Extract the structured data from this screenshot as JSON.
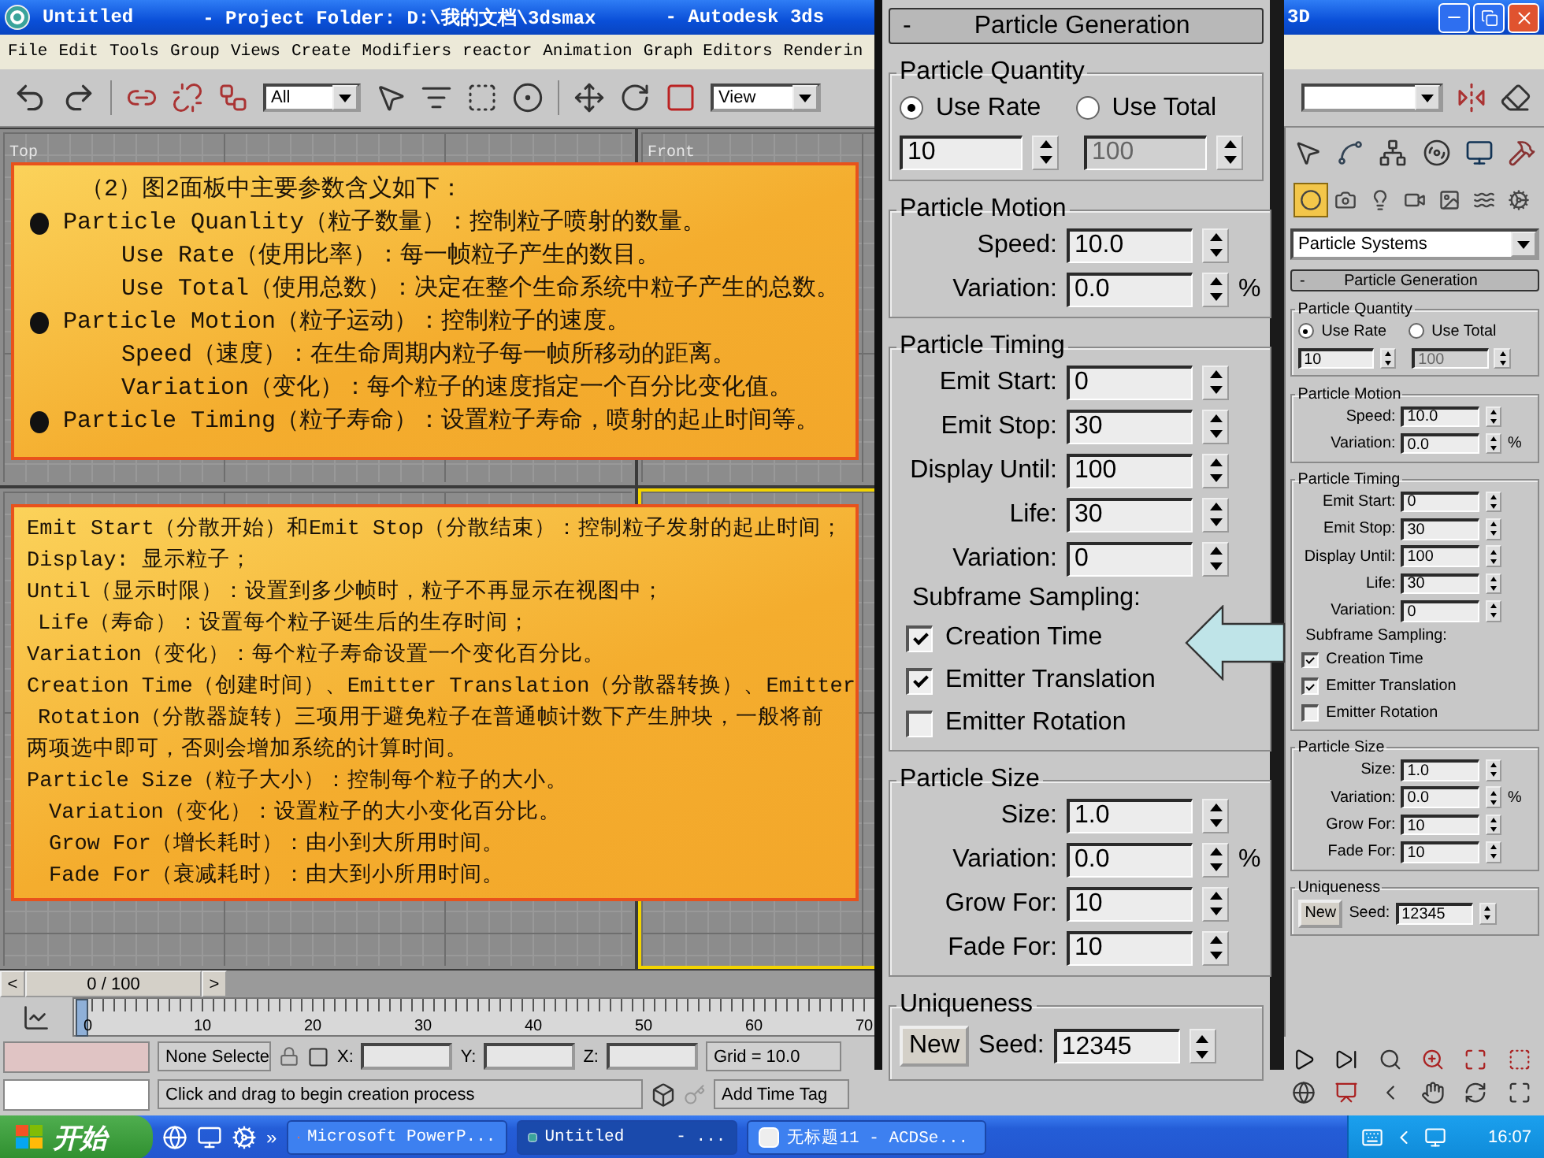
{
  "window": {
    "title": [
      "Untitled",
      "- Project Folder: D:\\我的文档\\3dsmax",
      "- Autodesk 3ds"
    ],
    "title_tail": "3D"
  },
  "menu": [
    "File",
    "Edit",
    "Tools",
    "Group",
    "Views",
    "Create",
    "Modifiers",
    "reactor",
    "Animation",
    "Graph Editors",
    "Renderin"
  ],
  "toolbar": {
    "selection_filter": "All",
    "reference_coord": "View"
  },
  "viewports": [
    {
      "label": "Top",
      "active": false
    },
    {
      "label": "Front",
      "active": false
    },
    {
      "active": false
    },
    {
      "active": true
    }
  ],
  "command_panel": {
    "object_types": [
      {
        "selected": true
      },
      {
        "selected": false
      },
      {
        "selected": false
      },
      {
        "selected": false
      },
      {
        "selected": false
      },
      {
        "selected": false
      },
      {
        "selected": false
      }
    ],
    "category": "Particle Systems",
    "rollout": {
      "collapse": "-",
      "title": "Particle Generation",
      "groups": [
        {
          "kind": "quantity",
          "title": "Particle Quantity",
          "radios": [
            {
              "label": "Use Rate",
              "selected": true
            },
            {
              "label": "Use Total",
              "selected": false
            }
          ],
          "fields": [
            {
              "value": "10",
              "disabled": false
            },
            {
              "value": "100",
              "disabled": true
            }
          ]
        },
        {
          "kind": "params",
          "title": "Particle Motion",
          "params": [
            {
              "label": "Speed:",
              "value": "10.0"
            },
            {
              "label": "Variation:",
              "value": "0.0",
              "unit": "%"
            }
          ]
        },
        {
          "kind": "params",
          "title": "Particle Timing",
          "params": [
            {
              "label": "Emit Start:",
              "value": "0"
            },
            {
              "label": "Emit Stop:",
              "value": "30"
            },
            {
              "label": "Display Until:",
              "value": "100"
            },
            {
              "label": "Life:",
              "value": "30"
            },
            {
              "label": "Variation:",
              "value": "0"
            }
          ],
          "caption": "Subframe Sampling:",
          "checks": [
            {
              "label": "Creation Time",
              "checked": true
            },
            {
              "label": "Emitter Translation",
              "checked": true
            },
            {
              "label": "Emitter Rotation",
              "checked": false
            }
          ]
        },
        {
          "kind": "params",
          "title": "Particle Size",
          "params": [
            {
              "label": "Size:",
              "value": "1.0"
            },
            {
              "label": "Variation:",
              "value": "0.0",
              "unit": "%"
            },
            {
              "label": "Grow For:",
              "value": "10"
            },
            {
              "label": "Fade For:",
              "value": "10"
            }
          ]
        },
        {
          "kind": "seed",
          "title": "Uniqueness",
          "button": "New",
          "label": "Seed:",
          "value": "12345"
        }
      ]
    }
  },
  "notes": [
    {
      "lines": [
        {
          "kind": "heading",
          "text": "（2）图2面板中主要参数含义如下："
        },
        {
          "kind": "bullet",
          "text": "Particle Quanlity（粒子数量）：控制粒子喷射的数量。"
        },
        {
          "kind": "sub",
          "text": "Use Rate（使用比率）：每一帧粒子产生的数目。"
        },
        {
          "kind": "sub",
          "text": "Use Total（使用总数）：决定在整个生命系统中粒子产生的总数。"
        },
        {
          "kind": "bullet",
          "text": "Particle Motion（粒子运动）：控制粒子的速度。"
        },
        {
          "kind": "sub",
          "text": "Speed（速度）：在生命周期内粒子每一帧所移动的距离。"
        },
        {
          "kind": "sub",
          "text": "Variation（变化）：每个粒子的速度指定一个百分比变化值。"
        },
        {
          "kind": "bullet",
          "text": "Particle Timing（粒子寿命）：设置粒子寿命，喷射的起止时间等。"
        }
      ]
    },
    {
      "lines": [
        {
          "kind": "plain",
          "text": "Emit Start（分散开始）和Emit Stop（分散结束）：控制粒子发射的起止时间；"
        },
        {
          "kind": "plain",
          "text": "Display: 显示粒子；"
        },
        {
          "kind": "plain",
          "text": "Until（显示时限）：设置到多少帧时，粒子不再显示在视图中；"
        },
        {
          "kind": "nudge",
          "text": "Life（寿命）：设置每个粒子诞生后的生存时间；"
        },
        {
          "kind": "plain",
          "text": "Variation（变化）：每个粒子寿命设置一个变化百分比。"
        },
        {
          "kind": "plain",
          "text": "Creation Time（创建时间）、Emitter Translation（分散器转换）、Emitter"
        },
        {
          "kind": "nudge",
          "text": "Rotation（分散器旋转）三项用于避免粒子在普通帧计数下产生肿块，一般将前"
        },
        {
          "kind": "plain",
          "text": "两项选中即可，否则会增加系统的计算时间。"
        },
        {
          "kind": "plain",
          "text": "Particle Size（粒子大小）：控制每个粒子的大小。"
        },
        {
          "kind": "minor",
          "text": "Variation（变化）：设置粒子的大小变化百分比。"
        },
        {
          "kind": "minor",
          "text": "Grow For（增长耗时）：由小到大所用时间。"
        },
        {
          "kind": "minor",
          "text": "Fade For（衰减耗时）：由大到小所用时间。"
        }
      ]
    }
  ],
  "enlarged_panel": {
    "rollout": {
      "collapse": "-",
      "title": "Particle Generation",
      "groups": [
        {
          "kind": "quantity",
          "title": "Particle Quantity",
          "radios": [
            {
              "label": "Use Rate",
              "selected": true
            },
            {
              "label": "Use Total",
              "selected": false
            }
          ],
          "fields": [
            {
              "value": "10",
              "disabled": false
            },
            {
              "value": "100",
              "disabled": true
            }
          ]
        },
        {
          "kind": "params",
          "title": "Particle Motion",
          "params": [
            {
              "label": "Speed:",
              "value": "10.0"
            },
            {
              "label": "Variation:",
              "value": "0.0",
              "unit": "%"
            }
          ]
        },
        {
          "kind": "params",
          "title": "Particle Timing",
          "params": [
            {
              "label": "Emit Start:",
              "value": "0"
            },
            {
              "label": "Emit Stop:",
              "value": "30"
            },
            {
              "label": "Display Until:",
              "value": "100"
            },
            {
              "label": "Life:",
              "value": "30"
            },
            {
              "label": "Variation:",
              "value": "0"
            }
          ],
          "caption": "Subframe Sampling:",
          "checks": [
            {
              "label": "Creation Time",
              "checked": true
            },
            {
              "label": "Emitter Translation",
              "checked": true
            },
            {
              "label": "Emitter Rotation",
              "checked": false
            }
          ]
        },
        {
          "kind": "params",
          "title": "Particle Size",
          "params": [
            {
              "label": "Size:",
              "value": "1.0"
            },
            {
              "label": "Variation:",
              "value": "0.0",
              "unit": "%"
            },
            {
              "label": "Grow For:",
              "value": "10"
            },
            {
              "label": "Fade For:",
              "value": "10"
            }
          ]
        },
        {
          "kind": "seed",
          "title": "Uniqueness",
          "button": "New",
          "label": "Seed:",
          "value": "12345"
        }
      ]
    }
  },
  "time_slider": {
    "prev": "<",
    "position": "0 / 100",
    "next": ">"
  },
  "track_bar": {
    "ticks": [
      "0",
      "10",
      "20",
      "30",
      "40",
      "50",
      "60",
      "70"
    ]
  },
  "status_bar": {
    "selection": "None Selecte",
    "x_label": "X:",
    "y_label": "Y:",
    "z_label": "Z:",
    "grid": "Grid = 10.0",
    "prompt": "Click and drag to begin creation process",
    "time_tag": "Add Time Tag"
  },
  "taskbar": {
    "start": "开始",
    "more": "»",
    "tasks": [
      {
        "label": "Microsoft PowerP...",
        "selected": false
      },
      {
        "label": "Untitled",
        "suffix": "- ...",
        "selected": true
      },
      {
        "label": "无标题11 - ACDSe...",
        "selected": false
      }
    ],
    "clock": "16:07"
  }
}
